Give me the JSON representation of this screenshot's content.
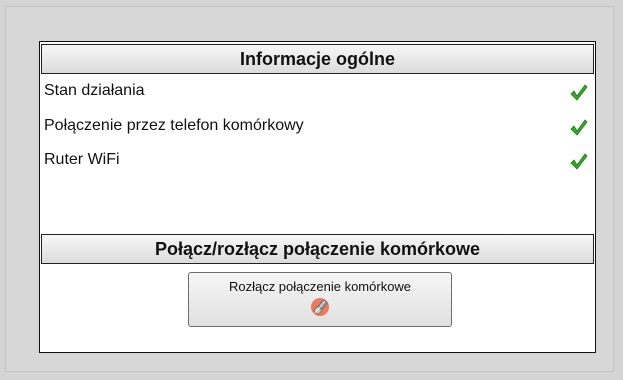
{
  "general_section": {
    "title": "Informacje ogólne",
    "rows": [
      {
        "label": "Stan działania",
        "status_icon": "check-icon",
        "status_color": "#3aa62a"
      },
      {
        "label": "Połączenie przez telefon komórkowy",
        "status_icon": "check-icon",
        "status_color": "#3aa62a"
      },
      {
        "label": "Ruter WiFi",
        "status_icon": "check-icon",
        "status_color": "#3aa62a"
      }
    ]
  },
  "cellular_section": {
    "title": "Połącz/rozłącz połączenie komórkowe",
    "button": {
      "label": "Rozłącz połączenie komórkowe",
      "icon": "unplug-icon"
    }
  }
}
